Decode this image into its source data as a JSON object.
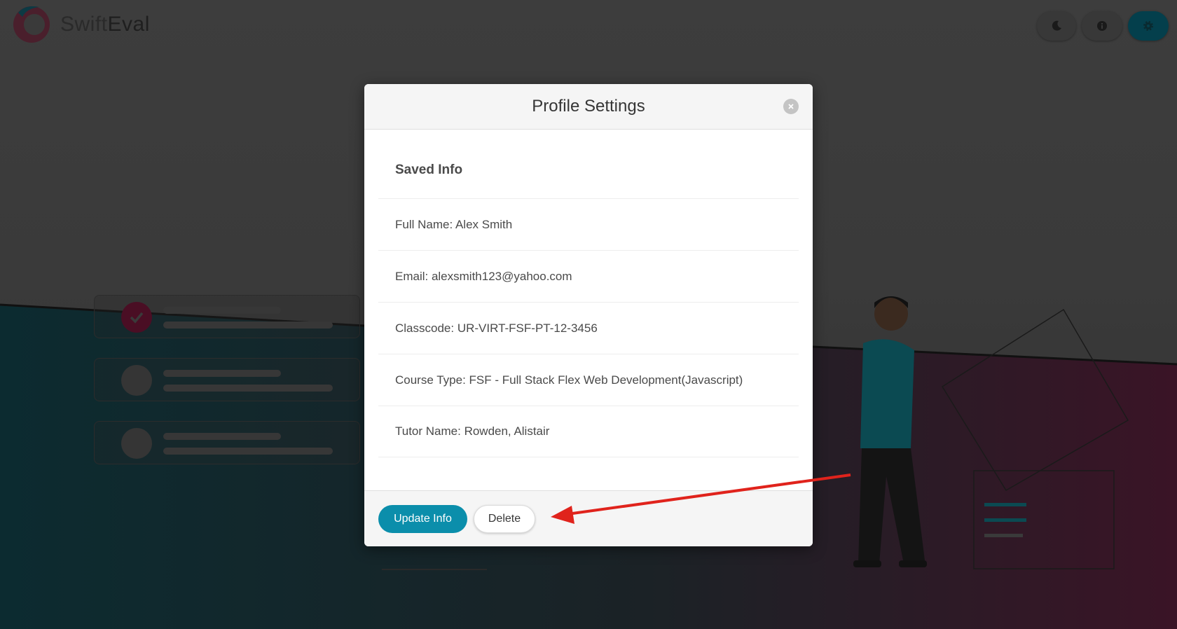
{
  "app": {
    "brand_prefix": "Swift",
    "brand_suffix": "Eval"
  },
  "topbar": {
    "buttons": [
      {
        "icon": "moon-icon"
      },
      {
        "icon": "info-icon"
      },
      {
        "icon": "gear-icon"
      }
    ]
  },
  "modal": {
    "title": "Profile Settings",
    "section_title": "Saved Info",
    "fields": [
      "Full Name: Alex Smith",
      "Email: alexsmith123@yahoo.com",
      "Classcode: UR-VIRT-FSF-PT-12-3456",
      "Course Type: FSF - Full Stack Flex Web Development(Javascript)",
      "Tutor Name: Rowden, Alistair"
    ],
    "update_label": "Update Info",
    "delete_label": "Delete"
  },
  "colors": {
    "primary": "#0b8eab",
    "annotation_arrow": "#e0231c",
    "gear_button": "#043f4c"
  }
}
